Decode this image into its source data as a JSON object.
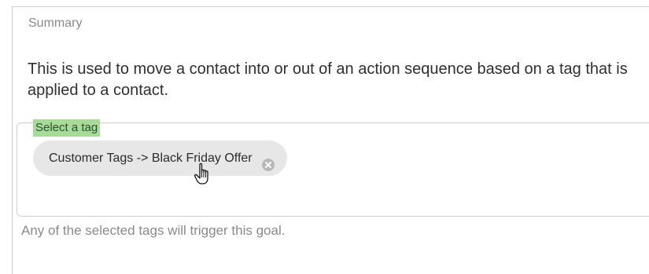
{
  "summary": {
    "label": "Summary",
    "description": "This is used to move a contact into or out of an action sequence based on a tag that is applied to a contact."
  },
  "tag_field": {
    "legend": "Select a tag",
    "selected_tags": [
      {
        "label": "Customer Tags -> Black Friday Offer",
        "remove_icon": "x-circle-icon"
      }
    ],
    "helper_text": "Any of the selected tags will trigger this goal."
  },
  "cursor": {
    "icon": "pointer-hand-icon"
  },
  "colors": {
    "legend_highlight": "#a6dc98",
    "chip_background": "#e7e7e7",
    "muted_text": "#8a8a8a",
    "body_text": "#2f2f2f",
    "border": "#cfcfcf"
  }
}
